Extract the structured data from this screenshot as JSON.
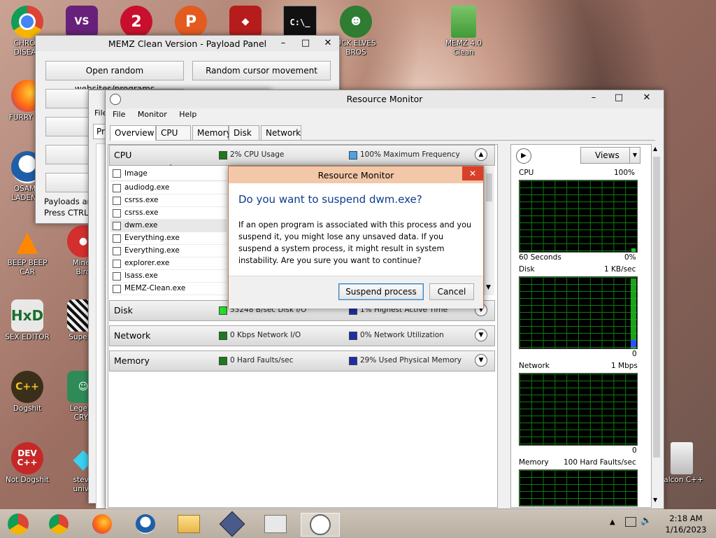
{
  "desktop": {
    "icons": [
      {
        "label": "CHRON\nDISEAS",
        "name": "chrome"
      },
      {
        "label": "",
        "name": "visual-studio"
      },
      {
        "label": "",
        "name": "game-2"
      },
      {
        "label": "",
        "name": "game-p"
      },
      {
        "label": "",
        "name": "red-banner"
      },
      {
        "label": "",
        "name": "cmd"
      },
      {
        "label": "UCK ELVES\nBROS",
        "name": "elves"
      },
      {
        "label": "MEMZ 4.0\nClean",
        "name": "memz"
      },
      {
        "label": "FURRY CU",
        "name": "firefox"
      },
      {
        "label": "OSAMA\nLADEN E",
        "name": "obama"
      },
      {
        "label": "BEEP BEEP\nCAR",
        "name": "vlc"
      },
      {
        "label": "Minec\nBird",
        "name": "angry"
      },
      {
        "label": "SEX EDITOR",
        "name": "hxd"
      },
      {
        "label": "Super C",
        "name": "qr"
      },
      {
        "label": "Dogshit",
        "name": "cpp"
      },
      {
        "label": "Legend\nCRYA",
        "name": "legend"
      },
      {
        "label": "Not Dogshit",
        "name": "devcpp"
      },
      {
        "label": "steve\nunive",
        "name": "gem"
      },
      {
        "label": "Falcon C++",
        "name": "recycle"
      }
    ]
  },
  "payload_panel": {
    "title": "MEMZ Clean Version - Payload Panel",
    "buttons": [
      "Open random websites/programs",
      "Random cursor movement",
      "Ran"
    ],
    "footer_line1": "Payloads are",
    "footer_line2": "Press CTRL+"
  },
  "back_window": {
    "menu_file": "File",
    "tab_partial": "Pr"
  },
  "resmon": {
    "title": "Resource Monitor",
    "menu": [
      "File",
      "Monitor",
      "Help"
    ],
    "tabs": [
      "Overview",
      "CPU",
      "Memory",
      "Disk",
      "Network"
    ],
    "sections": {
      "cpu": {
        "name": "CPU",
        "m1": "2% CPU Usage",
        "m2": "100% Maximum Frequency"
      },
      "disk": {
        "name": "Disk",
        "m1": "53248 B/sec Disk I/O",
        "m2": "1% Highest Active Time"
      },
      "network": {
        "name": "Network",
        "m1": "0 Kbps Network I/O",
        "m2": "0% Network Utilization"
      },
      "memory": {
        "name": "Memory",
        "m1": "0 Hard Faults/sec",
        "m2": "29% Used Physical Memory"
      }
    },
    "process_header": "Image",
    "processes": [
      "audiodg.exe",
      "csrss.exe",
      "csrss.exe",
      "dwm.exe",
      "Everything.exe",
      "Everything.exe",
      "explorer.exe",
      "lsass.exe",
      "MEMZ-Clean.exe"
    ],
    "views_label": "Views",
    "graphs": {
      "cpu": {
        "title": "CPU",
        "max": "100%",
        "bottom_left": "60 Seconds",
        "bottom_right": "0%"
      },
      "disk": {
        "title": "Disk",
        "max": "1 KB/sec",
        "bottom_right": "0"
      },
      "network": {
        "title": "Network",
        "max": "1 Mbps",
        "bottom_right": "0"
      },
      "memory": {
        "title": "Memory",
        "max": "100 Hard Faults/sec"
      }
    }
  },
  "dialog": {
    "title": "Resource Monitor",
    "heading": "Do you want to suspend dwm.exe?",
    "body": "If an open program is associated with this process and you suspend it, you might lose any unsaved data. If you suspend a system process, it might result in system instability. Are you sure you want to continue?",
    "confirm": "Suspend process",
    "cancel": "Cancel"
  },
  "taskbar": {
    "time": "2:18 AM",
    "date": "1/16/2023"
  }
}
